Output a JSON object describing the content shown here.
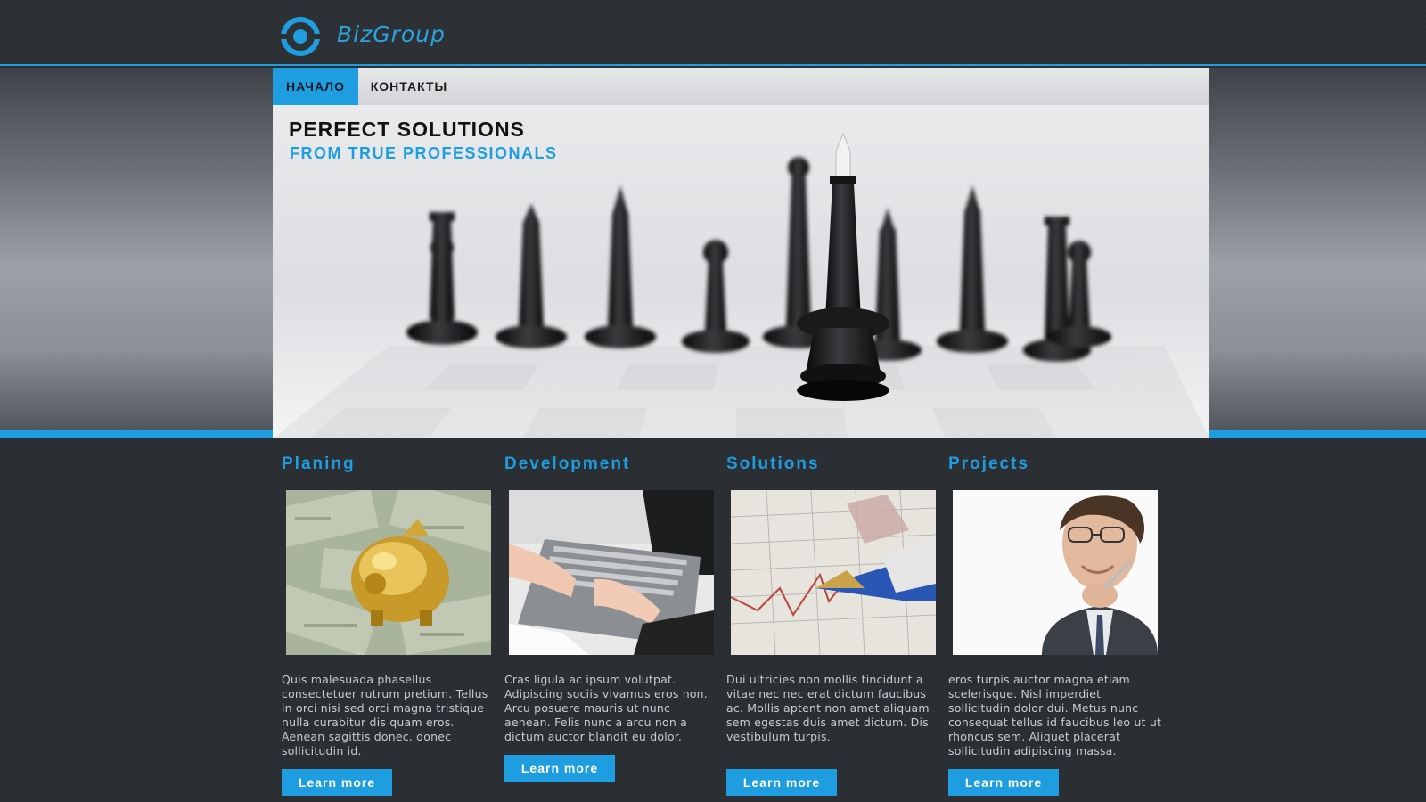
{
  "brand": {
    "name": "BizGroup",
    "logo_icon": "ring-logo-icon",
    "accent": "#1e9ee0"
  },
  "nav": {
    "items": [
      {
        "label": "НАЧАЛО",
        "active": true
      },
      {
        "label": "КОНТАКТЫ",
        "active": false
      }
    ]
  },
  "hero": {
    "title": "PERFECT SOLUTIONS",
    "subtitle": "FROM TRUE PROFESSIONALS",
    "image": "chess-pieces-photo"
  },
  "features": [
    {
      "title": "Planing",
      "image": "golden-piggy-bank-photo",
      "text": "Quis malesuada phasellus consectetuer rutrum pretium. Tellus in orci nisi sed orci magna tristique nulla curabitur dis quam eros. Aenean sagittis donec. donec sollicitudin id.",
      "button": "Learn more"
    },
    {
      "title": "Development",
      "image": "laptop-typing-photo",
      "text": "Cras ligula ac ipsum volutpat. Adipiscing sociis vivamus eros non. Arcu posuere mauris ut nunc aenean. Felis nunc a arcu non a dictum auctor blandit eu dolor.",
      "button": "Learn more"
    },
    {
      "title": "Solutions",
      "image": "stock-chart-pen-photo",
      "text": "Dui ultricies non mollis tincidunt a vitae nec nec erat dictum faucibus ac. Mollis aptent non amet aliquam sem egestas duis amet dictum. Dis vestibulum turpis.",
      "button": "Learn more"
    },
    {
      "title": "Projects",
      "image": "businessman-portrait-photo",
      "text": "eros turpis auctor magna etiam scelerisque. Nisl imperdiet sollicitudin dolor dui. Metus nunc consequat tellus id faucibus leo ut ut rhoncus sem. Aliquet placerat sollicitudin adipiscing massa.",
      "button": "Learn more"
    }
  ]
}
